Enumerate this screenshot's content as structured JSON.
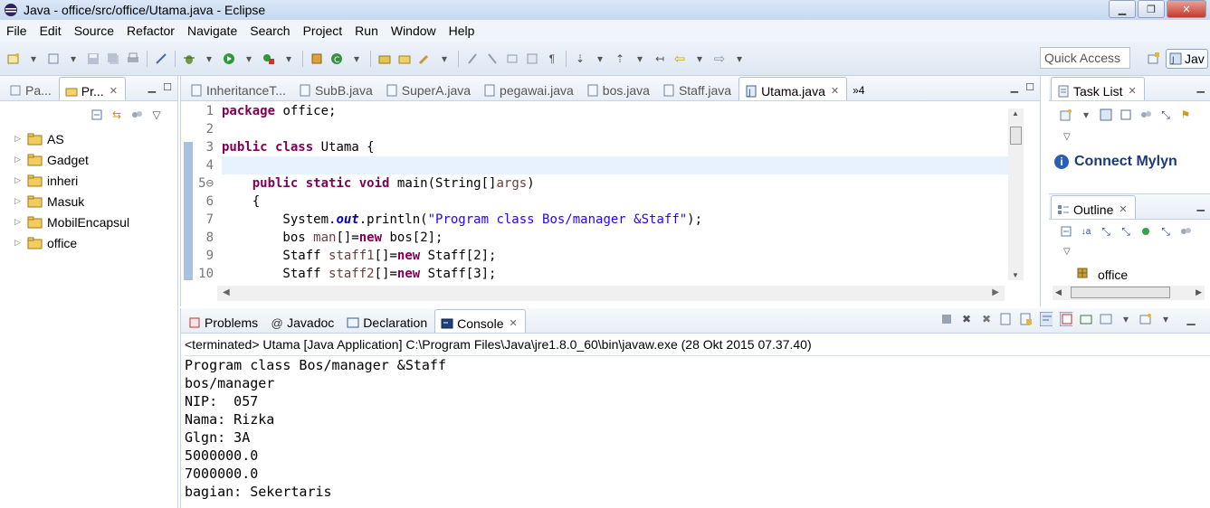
{
  "window": {
    "title": "Java - office/src/office/Utama.java - Eclipse"
  },
  "menu": [
    "File",
    "Edit",
    "Source",
    "Refactor",
    "Navigate",
    "Search",
    "Project",
    "Run",
    "Window",
    "Help"
  ],
  "toolbar": {
    "quick_access": "Quick Access",
    "perspective_label": "Jav"
  },
  "package_explorer": {
    "tabs": [
      {
        "label": "Pa...",
        "active": false
      },
      {
        "label": "Pr...",
        "active": true
      }
    ],
    "projects": [
      "AS",
      "Gadget",
      "inheri",
      "Masuk",
      "MobilEncapsul",
      "office"
    ]
  },
  "editor": {
    "tabs": [
      {
        "label": "InheritanceT...",
        "active": false
      },
      {
        "label": "SubB.java",
        "active": false
      },
      {
        "label": "SuperA.java",
        "active": false
      },
      {
        "label": "pegawai.java",
        "active": false
      },
      {
        "label": "bos.java",
        "active": false
      },
      {
        "label": "Staff.java",
        "active": false
      },
      {
        "label": "Utama.java",
        "active": true
      }
    ],
    "overflow": "»4",
    "line_numbers": [
      "1",
      "2",
      "3",
      "4",
      "5⊖",
      "6",
      "7",
      "8",
      "9",
      "10"
    ],
    "code": {
      "l1_kw": "package",
      "l1_rest": " office;",
      "l3_kw1": "public",
      "l3_kw2": "class",
      "l3_rest": " Utama {",
      "l5_indent": "    ",
      "l5_kw1": "public",
      "l5_kw2": "static",
      "l5_kw3": "void",
      "l5_rest": " main(String[]",
      "l5_var": "args",
      "l5_end": ")",
      "l6": "    {",
      "l7_a": "        System.",
      "l7_fld": "out",
      "l7_b": ".println(",
      "l7_str": "\"Program class Bos/manager &Staff\"",
      "l7_c": ");",
      "l8_a": "        bos ",
      "l8_var": "man",
      "l8_b": "[]=",
      "l8_kw": "new",
      "l8_c": " bos[2];",
      "l9_a": "        Staff ",
      "l9_var": "staff1",
      "l9_b": "[]=",
      "l9_kw": "new",
      "l9_c": " Staff[2];",
      "l10_a": "        Staff ",
      "l10_var": "staff2",
      "l10_b": "[]=",
      "l10_kw": "new",
      "l10_c": " Staff[3];"
    }
  },
  "task_list": {
    "tab": "Task List",
    "connect": "Connect Mylyn"
  },
  "outline": {
    "tab": "Outline",
    "item": "office"
  },
  "console": {
    "tabs": [
      {
        "label": "Problems",
        "active": false
      },
      {
        "label": "Javadoc",
        "active": false
      },
      {
        "label": "Declaration",
        "active": false
      },
      {
        "label": "Console",
        "active": true
      }
    ],
    "status": "<terminated> Utama [Java Application] C:\\Program Files\\Java\\jre1.8.0_60\\bin\\javaw.exe (28 Okt 2015 07.37.40)",
    "output": [
      "Program class Bos/manager &Staff",
      "bos/manager",
      "NIP:  057",
      "Nama: Rizka",
      "Glgn: 3A",
      "5000000.0",
      "7000000.0",
      "bagian: Sekertaris"
    ]
  },
  "colors": {
    "keyword": "#7f0055",
    "string": "#2a00ff",
    "field": "#0000c0",
    "variable": "#6a3e3e",
    "current_line": "#e8f2fe"
  }
}
